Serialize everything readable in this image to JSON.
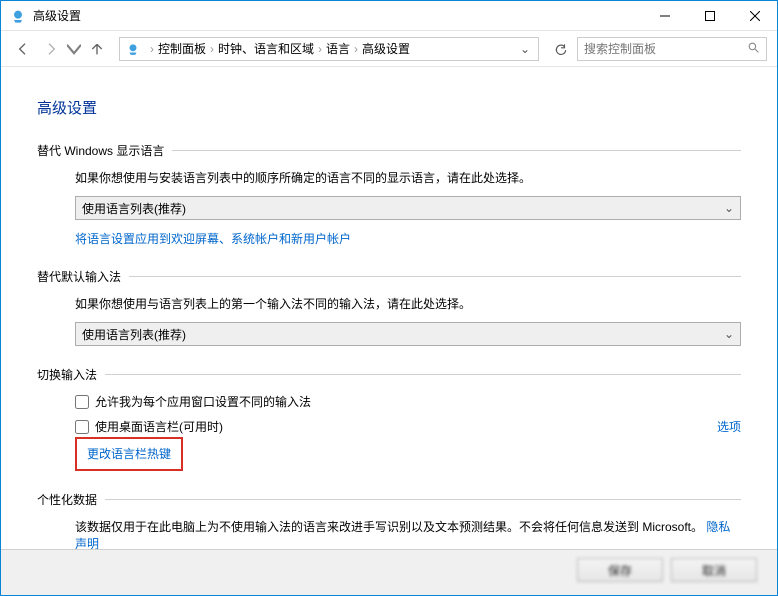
{
  "window": {
    "title": "高级设置"
  },
  "breadcrumb": {
    "root": "控制面板",
    "level1": "时钟、语言和区域",
    "level2": "语言",
    "current": "高级设置"
  },
  "search": {
    "placeholder": "搜索控制面板"
  },
  "page": {
    "heading": "高级设置"
  },
  "section_display": {
    "title": "替代 Windows 显示语言",
    "desc": "如果你想使用与安装语言列表中的顺序所确定的语言不同的显示语言，请在此处选择。",
    "select_value": "使用语言列表(推荐)",
    "link": "将语言设置应用到欢迎屏幕、系统帐户和新用户帐户"
  },
  "section_input": {
    "title": "替代默认输入法",
    "desc": "如果你想使用与语言列表上的第一个输入法不同的输入法，请在此处选择。",
    "select_value": "使用语言列表(推荐)"
  },
  "section_switch": {
    "title": "切换输入法",
    "check1": "允许我为每个应用窗口设置不同的输入法",
    "check2": "使用桌面语言栏(可用时)",
    "options_link": "选项",
    "hotkey_link": "更改语言栏热键"
  },
  "section_personal": {
    "title": "个性化数据",
    "desc_part1": "该数据仅用于在此电脑上为不使用输入法的语言来改进手写识别以及文本预测结果。不会将任何信息发送到 Microsoft。",
    "privacy_link": "隐私声明"
  },
  "footer": {
    "save": "保存",
    "cancel": "取消"
  }
}
